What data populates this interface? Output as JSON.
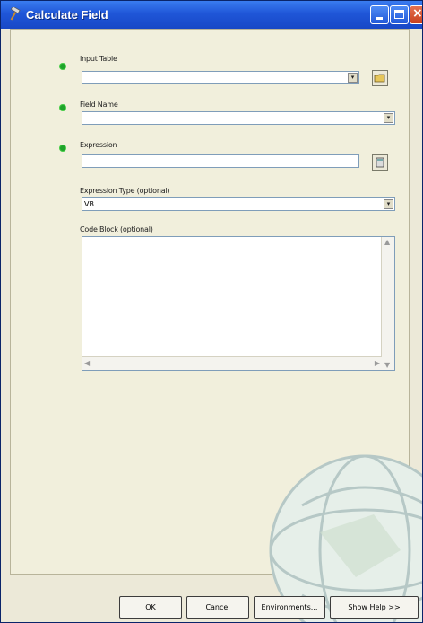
{
  "window": {
    "title": "Calculate Field",
    "controls": [
      "minimize-icon",
      "maximize-icon",
      "close-icon"
    ]
  },
  "form": {
    "input_table": {
      "label": "Input Table",
      "value": ""
    },
    "field_name": {
      "label": "Field Name",
      "value": ""
    },
    "expression": {
      "label": "Expression",
      "value": ""
    },
    "expression_type": {
      "label": "Expression Type (optional)",
      "value": "VB"
    },
    "code_block": {
      "label": "Code Block (optional)",
      "value": ""
    }
  },
  "buttons": {
    "ok": "OK",
    "cancel": "Cancel",
    "environments": "Environments...",
    "show_help": "Show Help >>"
  },
  "colors": {
    "title_bar": "#1f56d8",
    "required_marker": "#1fa32b",
    "dialog_bg": "#ece9d8"
  }
}
